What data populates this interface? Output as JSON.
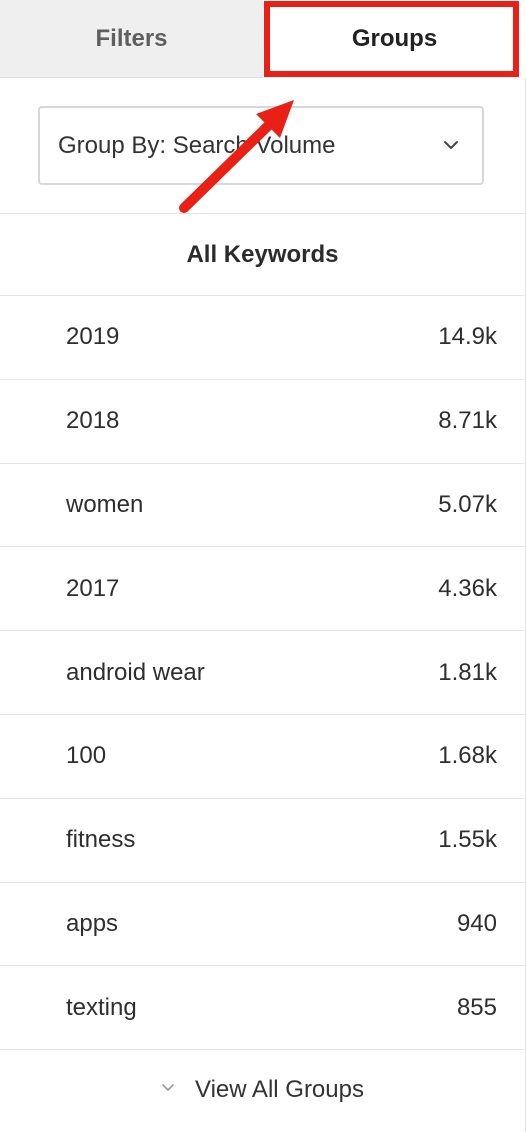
{
  "tabs": {
    "filters_label": "Filters",
    "groups_label": "Groups"
  },
  "group_by": {
    "value": "Group By: Search Volume",
    "icon": "chevron-down-icon"
  },
  "section": {
    "title": "All Keywords"
  },
  "groups": [
    {
      "name": "2019",
      "volume": "14.9k"
    },
    {
      "name": "2018",
      "volume": "8.71k"
    },
    {
      "name": "women",
      "volume": "5.07k"
    },
    {
      "name": "2017",
      "volume": "4.36k"
    },
    {
      "name": "android wear",
      "volume": "1.81k"
    },
    {
      "name": "100",
      "volume": "1.68k"
    },
    {
      "name": "fitness",
      "volume": "1.55k"
    },
    {
      "name": "apps",
      "volume": "940"
    },
    {
      "name": "texting",
      "volume": "855"
    }
  ],
  "footer": {
    "view_all_label": "View All Groups",
    "icon": "chevron-down-icon"
  },
  "colors": {
    "annotation": "#e82016",
    "inactive_tab_bg": "#efefef",
    "divider": "#e6e6e6"
  }
}
